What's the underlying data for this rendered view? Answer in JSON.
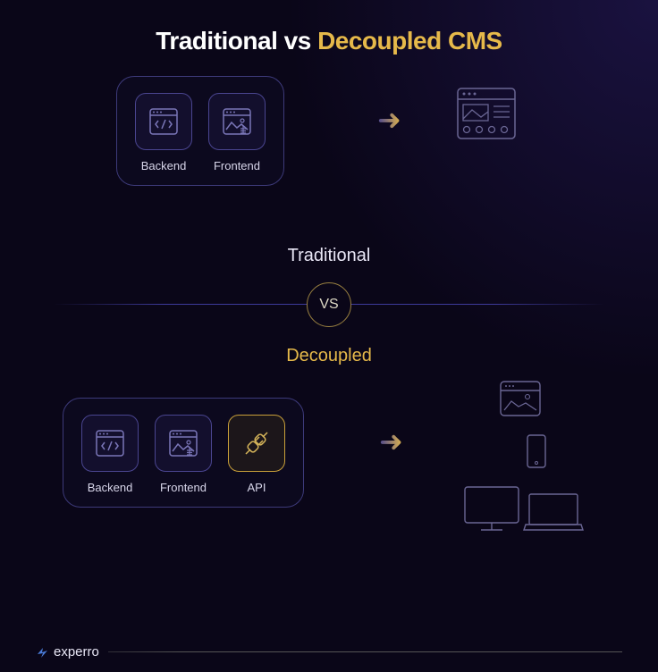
{
  "title": {
    "part1": "Traditional vs ",
    "part2": "Decoupled CMS"
  },
  "traditional": {
    "backend_label": "Backend",
    "frontend_label": "Frontend",
    "section_name": "Traditional"
  },
  "vs_label": "VS",
  "decoupled": {
    "backend_label": "Backend",
    "frontend_label": "Frontend",
    "api_label": "API",
    "section_name": "Decoupled"
  },
  "brand": "experro",
  "icons": {
    "backend": "code-window-icon",
    "frontend": "image-window-icon",
    "api": "plug-icon",
    "webpage": "webpage-icon",
    "phone": "phone-icon",
    "monitor": "monitor-icon",
    "laptop": "laptop-icon"
  }
}
